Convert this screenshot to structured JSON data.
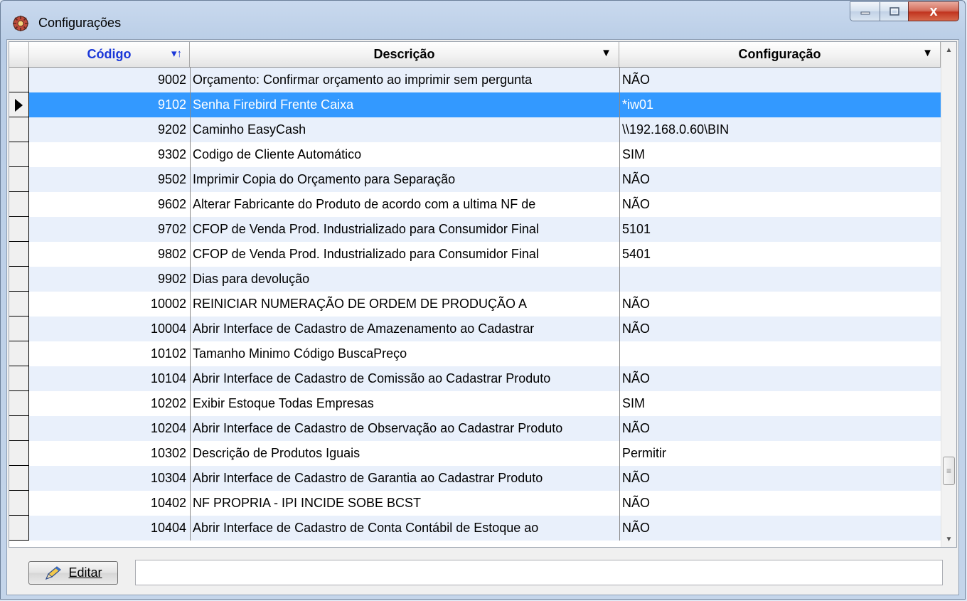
{
  "window": {
    "title": "Configurações",
    "close_glyph": "x"
  },
  "grid": {
    "columns": {
      "code": "Código",
      "desc": "Descrição",
      "conf": "Configuração"
    },
    "code_sort_glyph": "▾↑",
    "dropdown_glyph": "▼",
    "rows": [
      {
        "code": "9002",
        "desc": "Orçamento: Confirmar orçamento ao imprimir sem pergunta",
        "conf": "NÃO"
      },
      {
        "code": "9102",
        "desc": "Senha Firebird Frente Caixa",
        "conf": "*iw01"
      },
      {
        "code": "9202",
        "desc": "Caminho EasyCash",
        "conf": "\\\\192.168.0.60\\BIN"
      },
      {
        "code": "9302",
        "desc": "Codigo de Cliente Automático",
        "conf": "SIM"
      },
      {
        "code": "9502",
        "desc": "Imprimir Copia do Orçamento para Separação",
        "conf": "NÃO"
      },
      {
        "code": "9602",
        "desc": "Alterar Fabricante do Produto de acordo com a ultima NF de",
        "conf": "NÃO"
      },
      {
        "code": "9702",
        "desc": "CFOP de Venda Prod. Industrializado para Consumidor Final",
        "conf": "5101"
      },
      {
        "code": "9802",
        "desc": "CFOP de Venda Prod. Industrializado para Consumidor Final",
        "conf": "5401"
      },
      {
        "code": "9902",
        "desc": "Dias para devolução",
        "conf": ""
      },
      {
        "code": "10002",
        "desc": "REINICIAR NUMERAÇÃO DE ORDEM DE PRODUÇÃO A",
        "conf": "NÃO"
      },
      {
        "code": "10004",
        "desc": "Abrir Interface de Cadastro de Amazenamento ao Cadastrar",
        "conf": "NÃO"
      },
      {
        "code": "10102",
        "desc": "Tamanho Minimo Código BuscaPreço",
        "conf": ""
      },
      {
        "code": "10104",
        "desc": "Abrir Interface de Cadastro de Comissão ao Cadastrar Produto",
        "conf": "NÃO"
      },
      {
        "code": "10202",
        "desc": "Exibir Estoque Todas Empresas",
        "conf": "SIM"
      },
      {
        "code": "10204",
        "desc": "Abrir Interface de Cadastro de Observação ao Cadastrar Produto",
        "conf": "NÃO"
      },
      {
        "code": "10302",
        "desc": "Descrição de Produtos Iguais",
        "conf": "Permitir"
      },
      {
        "code": "10304",
        "desc": "Abrir Interface de Cadastro de Garantia ao Cadastrar Produto",
        "conf": "NÃO"
      },
      {
        "code": "10402",
        "desc": "NF PROPRIA - IPI INCIDE SOBE BCST",
        "conf": "NÃO"
      },
      {
        "code": "10404",
        "desc": "Abrir Interface de Cadastro de Conta Contábil de Estoque ao",
        "conf": "NÃO"
      }
    ]
  },
  "footer": {
    "edit_label": "Editar",
    "status_value": ""
  }
}
